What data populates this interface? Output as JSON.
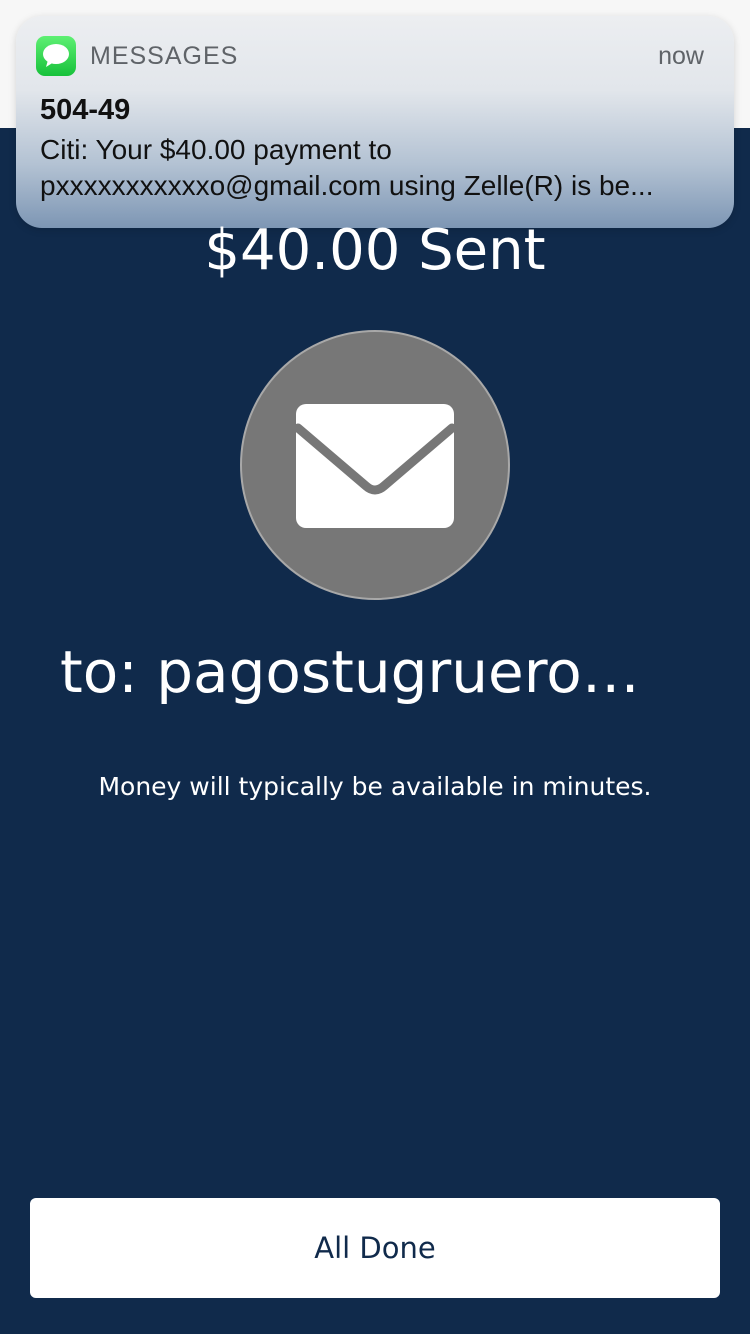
{
  "notification": {
    "app_icon": "messages-icon",
    "app_name": "MESSAGES",
    "time": "now",
    "sender": "504-49",
    "body_line1": "Citi: Your $40.00 payment to",
    "body_line2": "pxxxxxxxxxxxo@gmail.com using Zelle(R) is be..."
  },
  "confirmation": {
    "title": "$40.00 Sent",
    "icon": "envelope-icon",
    "recipient": "to: pagostugruero@g...",
    "availability_note": "Money will typically be available in minutes."
  },
  "actions": {
    "done_label": "All Done"
  },
  "colors": {
    "background": "#102a4b",
    "envelope_circle": "#777777",
    "button": "#ffffff",
    "button_text": "#102a4b"
  }
}
